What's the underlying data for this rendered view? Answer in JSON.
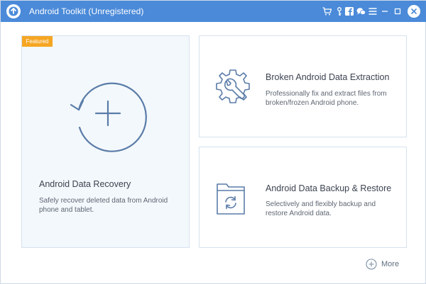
{
  "window": {
    "title": "Android Toolkit (Unregistered)"
  },
  "titlebar_icons": [
    {
      "icon": "cart-icon"
    },
    {
      "icon": "key-icon"
    },
    {
      "icon": "facebook-icon"
    },
    {
      "icon": "chat-icon"
    },
    {
      "icon": "menu-icon"
    },
    {
      "icon": "minimize-icon"
    },
    {
      "icon": "maximize-icon"
    },
    {
      "icon": "close-icon"
    }
  ],
  "cards": {
    "recovery": {
      "badge": "Featured",
      "title": "Android Data Recovery",
      "desc_line1": "Safely recover deleted data from Android",
      "desc_line2": "phone and tablet."
    },
    "extraction": {
      "title": "Broken Android Data Extraction",
      "desc_line1": "Professionally fix and extract files from",
      "desc_line2": "broken/frozen Android phone."
    },
    "backup": {
      "title": "Android Data Backup & Restore",
      "desc_line1": "Selectively and flexibly backup and",
      "desc_line2": "restore Android data."
    }
  },
  "more": {
    "label": "More"
  },
  "colors": {
    "titlebar": "#4a8ad9",
    "accent_icon": "#5a7ca8",
    "featured_badge": "#f6a623",
    "featured_bg": "#f3f8fc",
    "card_border": "#d6e2ee"
  }
}
